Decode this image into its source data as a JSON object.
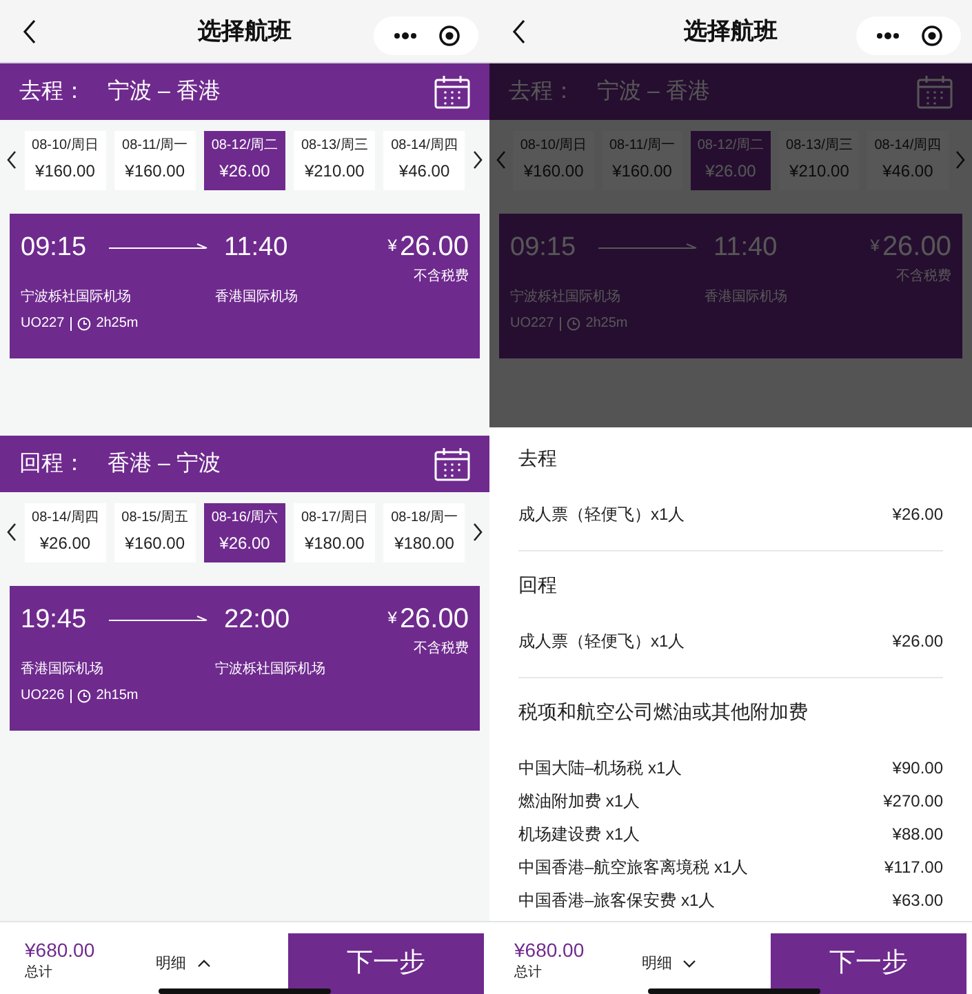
{
  "screens": [
    {
      "title": "选择航班",
      "details_expanded": false,
      "legs": [
        {
          "heading": "去程：",
          "route": "宁波 – 香港",
          "dates": [
            {
              "date": "08-10/周日",
              "price": "¥160.00",
              "selected": false
            },
            {
              "date": "08-11/周一",
              "price": "¥160.00",
              "selected": false
            },
            {
              "date": "08-12/周二",
              "price": "¥26.00",
              "selected": true
            },
            {
              "date": "08-13/周三",
              "price": "¥210.00",
              "selected": false
            },
            {
              "date": "08-14/周四",
              "price": "¥46.00",
              "selected": false
            }
          ],
          "flight": {
            "depart_time": "09:15",
            "arrive_time": "11:40",
            "currency": "¥",
            "price": "26.00",
            "tax_note": "不含税费",
            "depart_airport": "宁波栎社国际机场",
            "arrive_airport": "香港国际机场",
            "flight_no": "UO227",
            "duration": "2h25m"
          }
        },
        {
          "heading": "回程：",
          "route": "香港 – 宁波",
          "dates": [
            {
              "date": "08-14/周四",
              "price": "¥26.00",
              "selected": false
            },
            {
              "date": "08-15/周五",
              "price": "¥160.00",
              "selected": false
            },
            {
              "date": "08-16/周六",
              "price": "¥26.00",
              "selected": true
            },
            {
              "date": "08-17/周日",
              "price": "¥180.00",
              "selected": false
            },
            {
              "date": "08-18/周一",
              "price": "¥180.00",
              "selected": false
            }
          ],
          "flight": {
            "depart_time": "19:45",
            "arrive_time": "22:00",
            "currency": "¥",
            "price": "26.00",
            "tax_note": "不含税费",
            "depart_airport": "香港国际机场",
            "arrive_airport": "宁波栎社国际机场",
            "flight_no": "UO226",
            "duration": "2h15m"
          }
        }
      ],
      "footer": {
        "total": "¥680.00",
        "total_label": "总计",
        "details_label": "明细",
        "next_button": "下一步"
      }
    },
    {
      "title": "选择航班",
      "details_expanded": true,
      "legs": [
        {
          "heading": "去程：",
          "route": "宁波 – 香港",
          "dates": [
            {
              "date": "08-10/周日",
              "price": "¥160.00",
              "selected": false
            },
            {
              "date": "08-11/周一",
              "price": "¥160.00",
              "selected": false
            },
            {
              "date": "08-12/周二",
              "price": "¥26.00",
              "selected": true
            },
            {
              "date": "08-13/周三",
              "price": "¥210.00",
              "selected": false
            },
            {
              "date": "08-14/周四",
              "price": "¥46.00",
              "selected": false
            }
          ],
          "flight": {
            "depart_time": "09:15",
            "arrive_time": "11:40",
            "currency": "¥",
            "price": "26.00",
            "tax_note": "不含税费",
            "depart_airport": "宁波栎社国际机场",
            "arrive_airport": "香港国际机场",
            "flight_no": "UO227",
            "duration": "2h25m"
          }
        }
      ],
      "breakdown": [
        {
          "heading": "去程",
          "items": [
            {
              "label": "成人票（轻便飞）x1人",
              "amount": "¥26.00"
            }
          ]
        },
        {
          "heading": "回程",
          "items": [
            {
              "label": "成人票（轻便飞）x1人",
              "amount": "¥26.00"
            }
          ]
        },
        {
          "heading": "税项和航空公司燃油或其他附加费",
          "items": [
            {
              "label": "中国大陆–机场税 x1人",
              "amount": "¥90.00"
            },
            {
              "label": "燃油附加费 x1人",
              "amount": "¥270.00"
            },
            {
              "label": "机场建设费 x1人",
              "amount": "¥88.00"
            },
            {
              "label": "中国香港–航空旅客离境税 x1人",
              "amount": "¥117.00"
            },
            {
              "label": "中国香港–旅客保安费 x1人",
              "amount": "¥63.00"
            }
          ]
        }
      ],
      "footer": {
        "total": "¥680.00",
        "total_label": "总计",
        "details_label": "明细",
        "next_button": "下一步"
      }
    }
  ]
}
